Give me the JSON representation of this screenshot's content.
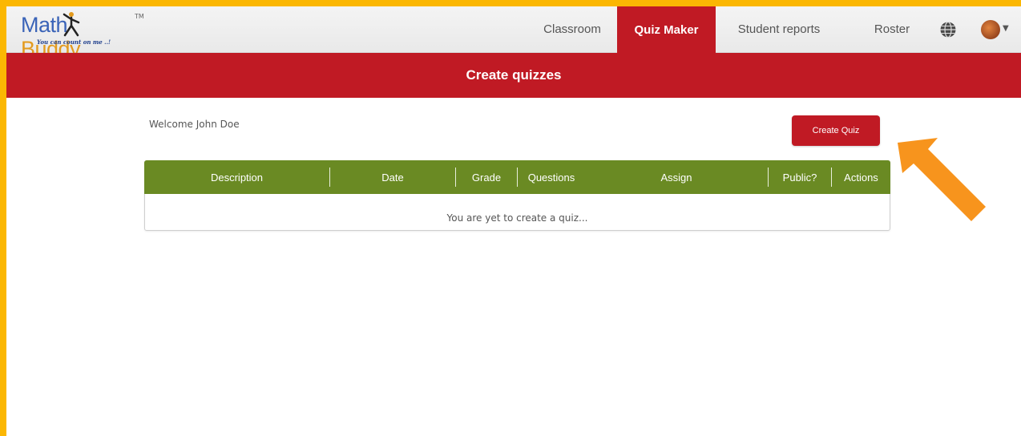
{
  "brand": {
    "name_part1": "Math",
    "name_part2": "Buddy",
    "trademark": "TM",
    "tagline": "You can count on me ..!"
  },
  "nav": {
    "items": [
      {
        "label": "Classroom",
        "active": false
      },
      {
        "label": "Quiz Maker",
        "active": true
      },
      {
        "label": "Student reports",
        "active": false
      },
      {
        "label": "Roster",
        "active": false
      }
    ],
    "icons": [
      "globe-icon",
      "avatar"
    ]
  },
  "banner": {
    "title": "Create quizzes"
  },
  "welcome_text": "Welcome John Doe",
  "create_button_label": "Create Quiz",
  "table": {
    "columns": [
      "Description",
      "Date",
      "Grade",
      "Questions",
      "Assign",
      "Public?",
      "Actions"
    ],
    "empty_message": "You are yet to create a quiz..."
  },
  "colors": {
    "accent_red": "#c01a24",
    "header_green": "#6a8a23",
    "highlight_orange": "#fbb703",
    "arrow_orange": "#f7941d"
  }
}
